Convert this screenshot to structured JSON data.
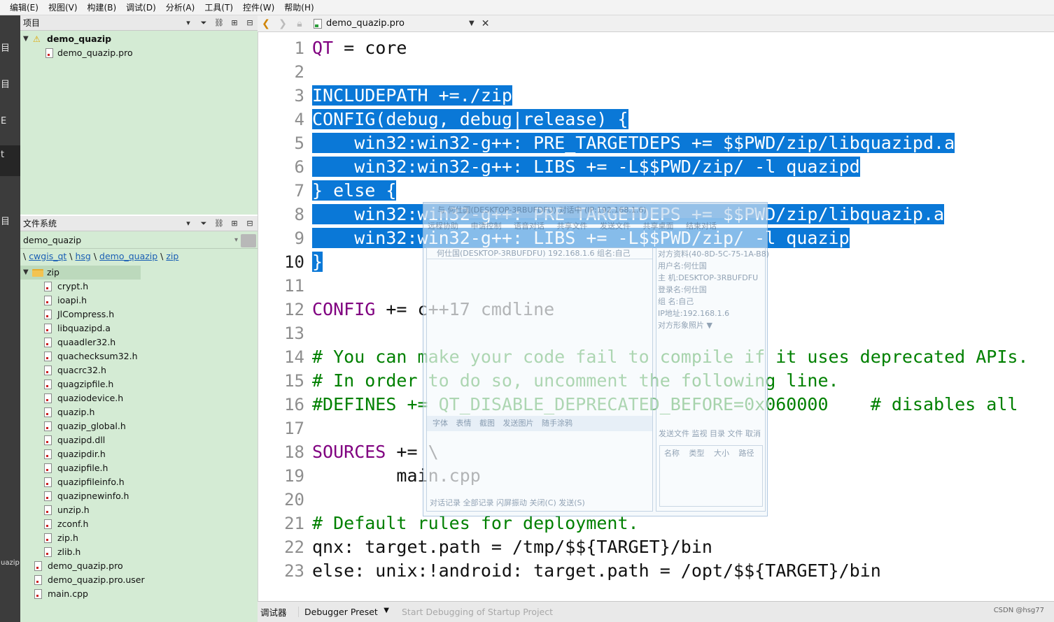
{
  "menu": [
    "编辑(E)",
    "视图(V)",
    "构建(B)",
    "调试(D)",
    "分析(A)",
    "工具(T)",
    "控件(W)",
    "帮助(H)"
  ],
  "modebar": {
    "fragments": [
      "目",
      "目",
      "E",
      "t",
      "目",
      "uazip"
    ]
  },
  "project_pane": {
    "title": "项目",
    "root": "demo_quazip",
    "children": [
      "demo_quazip.pro"
    ]
  },
  "fs_pane": {
    "title": "文件系统",
    "combo_value": "demo_quazip",
    "breadcrumb": [
      "cwgis_qt",
      "hsg",
      "demo_quazip",
      "zip"
    ],
    "folder": "zip",
    "zip_files": [
      "crypt.h",
      "ioapi.h",
      "JlCompress.h",
      "libquazipd.a",
      "quaadler32.h",
      "quachecksum32.h",
      "quacrc32.h",
      "quagzipfile.h",
      "quaziodevice.h",
      "quazip.h",
      "quazip_global.h",
      "quazipd.dll",
      "quazipdir.h",
      "quazipfile.h",
      "quazipfileinfo.h",
      "quazipnewinfo.h",
      "unzip.h",
      "zconf.h",
      "zip.h",
      "zlib.h"
    ],
    "root_files": [
      "demo_quazip.pro",
      "demo_quazip.pro.user",
      "main.cpp"
    ]
  },
  "editor": {
    "file_name": "demo_quazip.pro",
    "current_line": "10",
    "line_numbers": [
      "1",
      "2",
      "3",
      "4",
      "5",
      "6",
      "7",
      "8",
      "9",
      "10",
      "11",
      "12",
      "13",
      "14",
      "15",
      "16",
      "17",
      "18",
      "19",
      "20",
      "21",
      "22",
      "23"
    ],
    "lines": [
      "QT = core",
      "",
      "INCLUDEPATH +=./zip",
      "CONFIG(debug, debug|release) {",
      "    win32:win32-g++: PRE_TARGETDEPS += $$PWD/zip/libquazipd.a",
      "    win32:win32-g++: LIBS += -L$$PWD/zip/ -l quazipd",
      "} else {",
      "    win32:win32-g++: PRE_TARGETDEPS += $$PWD/zip/libquazip.a",
      "    win32:win32-g++: LIBS += -L$$PWD/zip/ -l quazip",
      "}",
      "",
      "CONFIG += c++17 cmdline",
      "",
      "# You can make your code fail to compile if it uses deprecated APIs.",
      "# In order to do so, uncomment the following line.",
      "#DEFINES += QT_DISABLE_DEPRECATED_BEFORE=0x060000    # disables all",
      "",
      "SOURCES += \\",
      "        main.cpp",
      "",
      "# Default rules for deployment.",
      "qnx: target.path = /tmp/$${TARGET}/bin",
      "else: unix:!android: target.path = /opt/$${TARGET}/bin"
    ]
  },
  "overlay_window": {
    "title": "与 何仕国(DESKTOP-3RBUFDFU) 对话中 (IP:192.168.1.6)",
    "toolbar": "远程协助 申请控制 语音对话 共享文件 发送文件 共享桌面 结束对话",
    "peer_line": "何仕国(DESKTOP-3RBUFDFU) 192.168.1.6 组名:自己",
    "info": [
      "对方资料(40-8D-5C-75-1A-B8)",
      "用户名:何仕国",
      "主  机:DESKTOP-3RBUFDFU",
      "登录名:何仕国",
      "组  名:自己",
      "IP地址:192.168.1.6",
      "对方形象照片 ▼"
    ],
    "format_bar": "字体 表情 截图 发送图片 随手涂鸦",
    "actions": "对话记录 全部记录 闪屏振动  关闭(C)  发送(S)",
    "file_tabs": "发送文件 监视 目录 文件 取消",
    "columns": "名称 类型 大小 路径"
  },
  "statusbar": {
    "debugger_label": "调试器",
    "preset": "Debugger Preset",
    "start": "Start Debugging of Startup Project",
    "watermark": "CSDN @hsg77"
  }
}
